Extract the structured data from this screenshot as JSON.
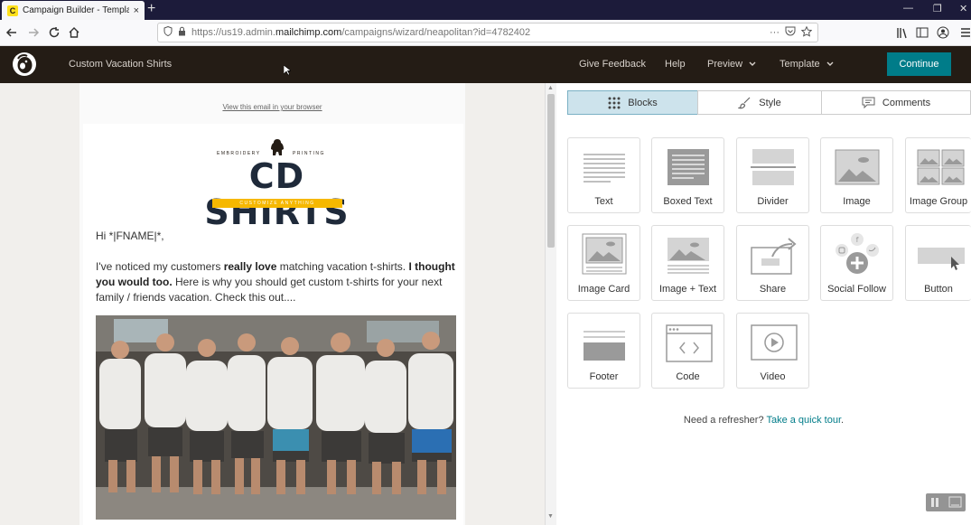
{
  "browser": {
    "tab_title": "Campaign Builder - Template (",
    "tab_favicon": "C",
    "tab_close": "×",
    "newtab": "+",
    "url_prefix": "https://us19.admin.",
    "url_domain": "mailchimp.com",
    "url_path": "/campaigns/wizard/neapolitan?id=4782402",
    "url_more": "···",
    "min": "—",
    "restore": "❐",
    "close": "✕"
  },
  "app": {
    "campaign_name": "Custom Vacation Shirts",
    "give_feedback": "Give Feedback",
    "help": "Help",
    "preview": "Preview",
    "template": "Template",
    "continue": "Continue",
    "accent": "#007c89"
  },
  "email": {
    "view_in_browser": "View this email in your browser",
    "logo_left": "EMBROIDERY",
    "logo_right": "PRINTING",
    "logo_main": "CD SHIRTS",
    "logo_strip": "CUSTOMIZE ANYTHING",
    "greeting": "Hi *|FNAME|*,",
    "p1_a": "I've noticed my customers ",
    "p1_b": "really love",
    "p1_c": " matching vacation t-shirts. ",
    "p1_d": "I thought you would too.",
    "p1_e": " Here is why you should get custom t-shirts for your next family / friends vacation. Check this out...."
  },
  "panel": {
    "tabs": [
      {
        "label": "Blocks",
        "icon": "grid-icon"
      },
      {
        "label": "Style",
        "icon": "brush-icon"
      },
      {
        "label": "Comments",
        "icon": "comment-icon"
      }
    ],
    "blocks": [
      {
        "label": "Text",
        "icon": "text-block-icon"
      },
      {
        "label": "Boxed Text",
        "icon": "boxed-text-icon"
      },
      {
        "label": "Divider",
        "icon": "divider-icon"
      },
      {
        "label": "Image",
        "icon": "image-icon"
      },
      {
        "label": "Image Group",
        "icon": "image-group-icon"
      },
      {
        "label": "Image Card",
        "icon": "image-card-icon"
      },
      {
        "label": "Image + Text",
        "icon": "image-text-icon"
      },
      {
        "label": "Share",
        "icon": "share-icon"
      },
      {
        "label": "Social Follow",
        "icon": "social-follow-icon"
      },
      {
        "label": "Button",
        "icon": "button-icon"
      },
      {
        "label": "Footer",
        "icon": "footer-icon"
      },
      {
        "label": "Code",
        "icon": "code-icon"
      },
      {
        "label": "Video",
        "icon": "video-icon"
      }
    ],
    "refresher_text": "Need a refresher? ",
    "refresher_link": "Take a quick tour",
    "refresher_end": "."
  }
}
